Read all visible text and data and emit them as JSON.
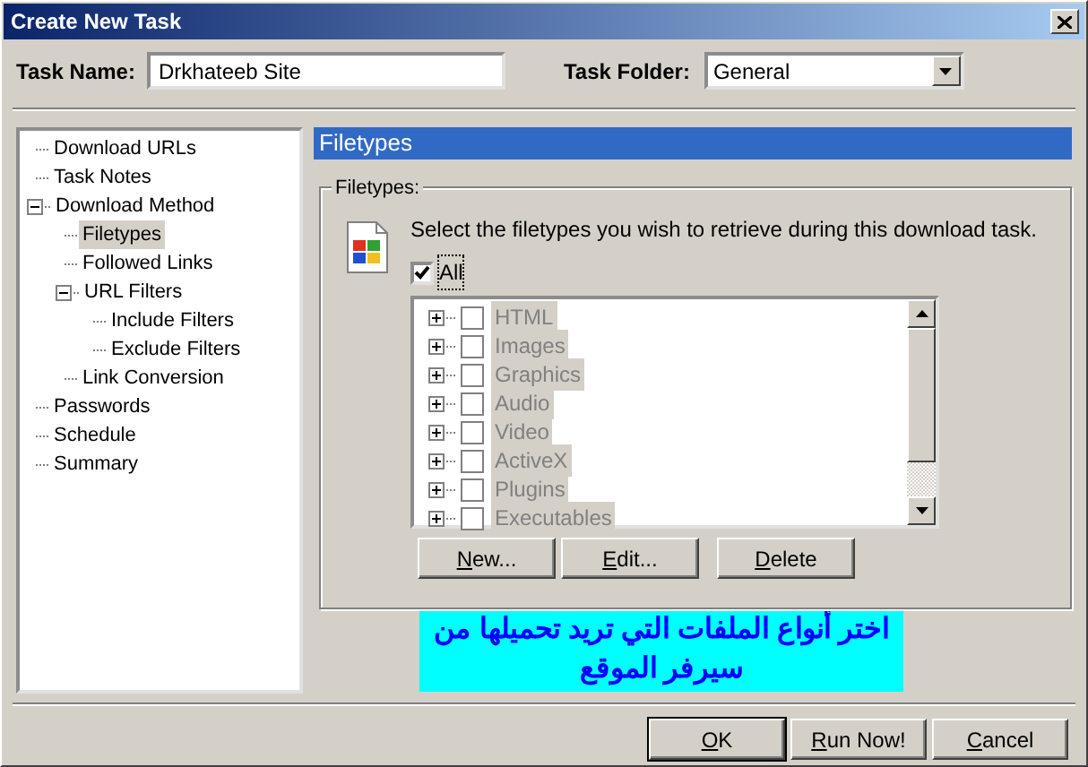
{
  "window": {
    "title": "Create New Task"
  },
  "task_name": {
    "label": "Task Name:",
    "value": "Drkhateeb Site"
  },
  "task_folder": {
    "label": "Task Folder:",
    "value": "General"
  },
  "tree": [
    {
      "label": "Download URLs",
      "selected": false
    },
    {
      "label": "Task Notes",
      "selected": false
    },
    {
      "label": "Download Method",
      "selected": false,
      "expanded": true,
      "children": [
        {
          "label": "Filetypes",
          "selected": true
        },
        {
          "label": "Followed Links",
          "selected": false
        },
        {
          "label": "URL Filters",
          "selected": false,
          "expanded": true,
          "children": [
            {
              "label": "Include Filters",
              "selected": false
            },
            {
              "label": "Exclude Filters",
              "selected": false
            }
          ]
        },
        {
          "label": "Link Conversion",
          "selected": false
        }
      ]
    },
    {
      "label": "Passwords",
      "selected": false
    },
    {
      "label": "Schedule",
      "selected": false
    },
    {
      "label": "Summary",
      "selected": false
    }
  ],
  "panel": {
    "header": "Filetypes",
    "group_label": "Filetypes:",
    "instruction": "Select the filetypes you wish to retrieve during this download task.",
    "all": {
      "label": "All",
      "checked": true
    },
    "filetypes": [
      {
        "label": "HTML",
        "checked": false,
        "disabled": true
      },
      {
        "label": "Images",
        "checked": false,
        "disabled": true
      },
      {
        "label": "Graphics",
        "checked": false,
        "disabled": true
      },
      {
        "label": "Audio",
        "checked": false,
        "disabled": true
      },
      {
        "label": "Video",
        "checked": false,
        "disabled": true
      },
      {
        "label": "ActiveX",
        "checked": false,
        "disabled": true
      },
      {
        "label": "Plugins",
        "checked": false,
        "disabled": true
      },
      {
        "label": "Executables",
        "checked": false,
        "disabled": true
      }
    ],
    "buttons": [
      "New...",
      "Edit...",
      "Delete"
    ]
  },
  "note": "اختر أنواع الملفات التي تريد تحميلها من سيرفر الموقع",
  "buttons": [
    {
      "label": "OK",
      "default": true
    },
    {
      "label": "Run Now!",
      "default": false
    },
    {
      "label": "Cancel",
      "default": false
    }
  ]
}
